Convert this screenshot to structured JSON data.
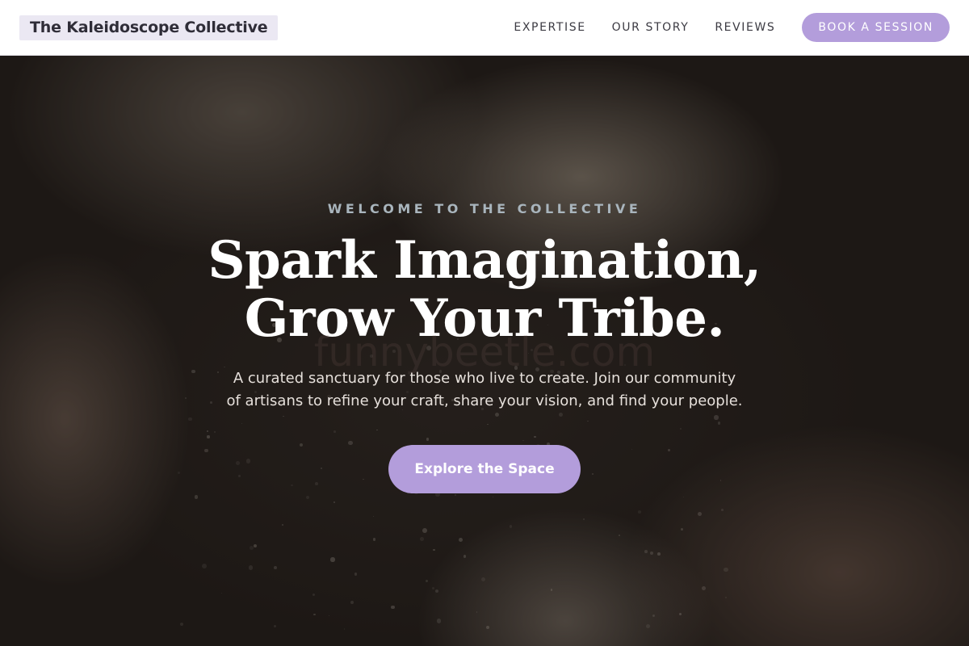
{
  "header": {
    "brand": "The Kaleidoscope Collective",
    "nav": [
      {
        "label": "EXPERTISE"
      },
      {
        "label": "OUR STORY"
      },
      {
        "label": "REVIEWS"
      }
    ],
    "cta_label": "BOOK A SESSION"
  },
  "hero": {
    "eyebrow": "WELCOME TO THE COLLECTIVE",
    "headline_line1": "Spark Imagination,",
    "headline_line2": "Grow Your Tribe.",
    "watermark": "funnybeetle.com",
    "subtext_line1": "A curated sanctuary for those who live to create. Join our community",
    "subtext_line2": "of artisans to refine your craft, share your vision, and find your people.",
    "cta_label": "Explore the Space"
  },
  "colors": {
    "accent": "#b39ddb",
    "brand_bg": "#ebe8f3",
    "eyebrow": "#a9b5bd",
    "header_bg": "#ffffff"
  }
}
